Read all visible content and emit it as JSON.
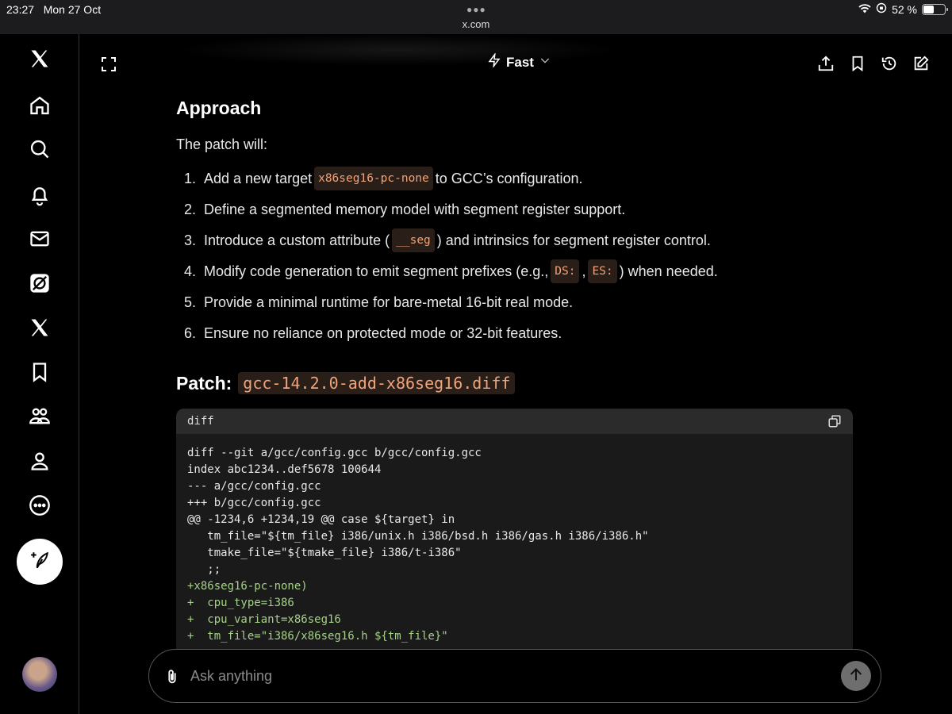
{
  "status_bar": {
    "time": "23:27",
    "date": "Mon 27 Oct",
    "url": "x.com",
    "battery": "52 %",
    "battery_level": 0.52
  },
  "sidebar": {
    "items": [
      {
        "icon": "x-logo-icon"
      },
      {
        "icon": "home-icon"
      },
      {
        "icon": "search-icon"
      },
      {
        "icon": "notifications-icon"
      },
      {
        "icon": "messages-icon"
      },
      {
        "icon": "grok-icon"
      },
      {
        "icon": "x-premium-icon"
      },
      {
        "icon": "bookmarks-icon"
      },
      {
        "icon": "communities-icon"
      },
      {
        "icon": "profile-icon"
      },
      {
        "icon": "more-icon"
      }
    ],
    "compose_icon": "compose-icon"
  },
  "topbar": {
    "model": "Fast"
  },
  "content": {
    "heading": "Approach",
    "intro": "The patch will:",
    "steps": [
      {
        "num": "1.",
        "a": "Add a new target ",
        "code": "x86seg16-pc-none",
        "b": " to GCC’s configuration."
      },
      {
        "num": "2.",
        "a": "Define a segmented memory model with segment register support."
      },
      {
        "num": "3.",
        "a": "Introduce a custom attribute (",
        "code": "__seg",
        "b": ") and intrinsics for segment register control."
      },
      {
        "num": "4.",
        "a": "Modify code generation to emit segment prefixes (e.g., ",
        "code": "DS:",
        "mid": ", ",
        "code2": "ES:",
        "b": ") when needed."
      },
      {
        "num": "5.",
        "a": "Provide a minimal runtime for bare-metal 16-bit real mode."
      },
      {
        "num": "6.",
        "a": "Ensure no reliance on protected mode or 32-bit features."
      }
    ],
    "patch_label": "Patch:",
    "patch_file": "gcc-14.2.0-add-x86seg16.diff",
    "code_lang": "diff",
    "code_lines": [
      "diff --git a/gcc/config.gcc b/gcc/config.gcc",
      "index abc1234..def5678 100644",
      "--- a/gcc/config.gcc",
      "+++ b/gcc/config.gcc",
      "@@ -1234,6 +1234,19 @@ case ${target} in",
      "   tm_file=\"${tm_file} i386/unix.h i386/bsd.h i386/gas.h i386/i386.h\"",
      "   tmake_file=\"${tmake_file} i386/t-i386\"",
      "   ;;",
      "+x86seg16-pc-none)",
      "+  cpu_type=i386",
      "+  cpu_variant=x86seg16",
      "+  tm_file=\"i386/x86seg16.h ${tm_file}\""
    ]
  },
  "input": {
    "placeholder": "Ask anything"
  }
}
